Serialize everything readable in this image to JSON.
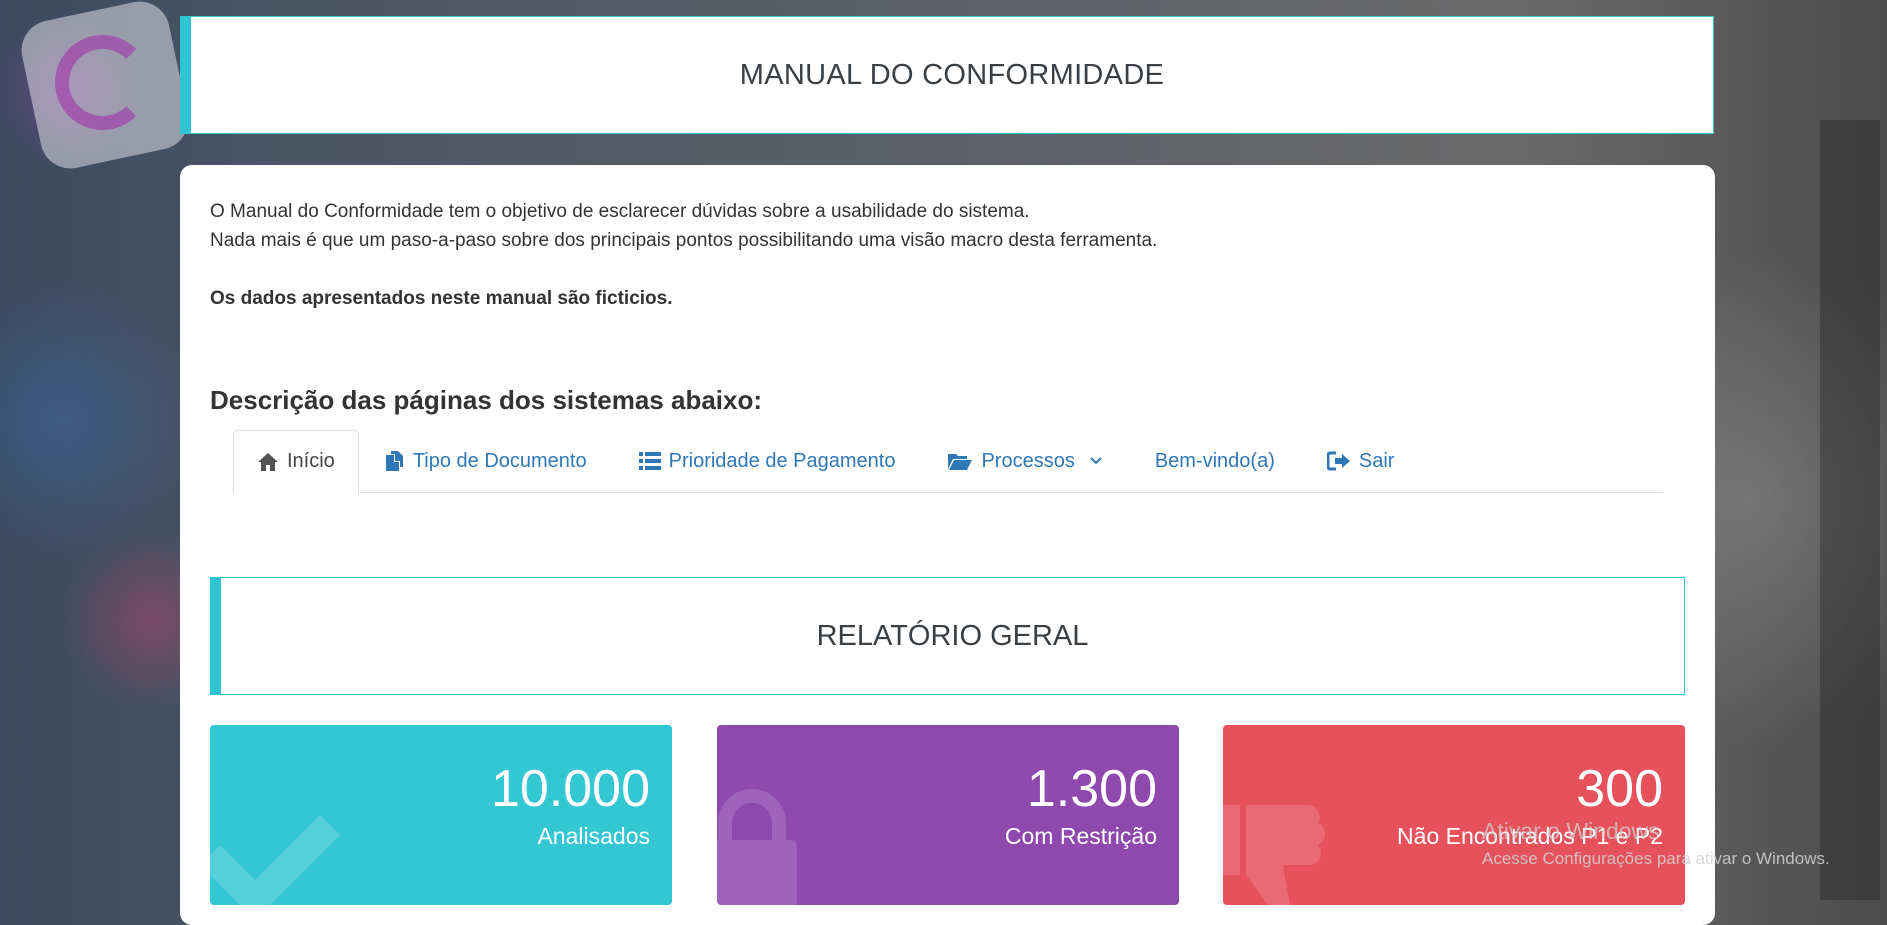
{
  "header": {
    "title": "MANUAL DO CONFORMIDADE"
  },
  "intro": {
    "line1": "O Manual do Conformidade tem o objetivo de esclarecer dúvidas sobre a usabilidade do sistema.",
    "line2": "Nada mais é que um paso-a-paso sobre dos principais pontos possibilitando uma visão macro desta ferramenta.",
    "note": "Os dados apresentados neste manual são ficticios."
  },
  "section_title": "Descrição das páginas dos sistemas abaixo:",
  "tabs": [
    {
      "label": "Início",
      "icon": "home-icon",
      "active": true
    },
    {
      "label": "Tipo de Documento",
      "icon": "documents-icon"
    },
    {
      "label": "Prioridade de Pagamento",
      "icon": "list-icon"
    },
    {
      "label": "Processos",
      "icon": "folder-open-icon",
      "dropdown": true
    },
    {
      "label": "Bem-vindo(a)"
    },
    {
      "label": "Sair",
      "icon": "sign-out-icon"
    }
  ],
  "report": {
    "title": "RELATÓRIO GERAL"
  },
  "stats": [
    {
      "value": "10.000",
      "label": "Analisados",
      "color": "#33c6d3",
      "icon": "check-icon"
    },
    {
      "value": "1.300",
      "label": "Com Restrição",
      "color": "#8e48ae",
      "icon": "lock-icon"
    },
    {
      "value": "300",
      "label": "Não Encontrados P1 e P2",
      "color": "#e6515b",
      "icon": "thumbs-down-icon"
    }
  ],
  "watermark": {
    "line1": "Ativar o Windows",
    "line2": "Acesse Configurações para ativar o Windows."
  }
}
